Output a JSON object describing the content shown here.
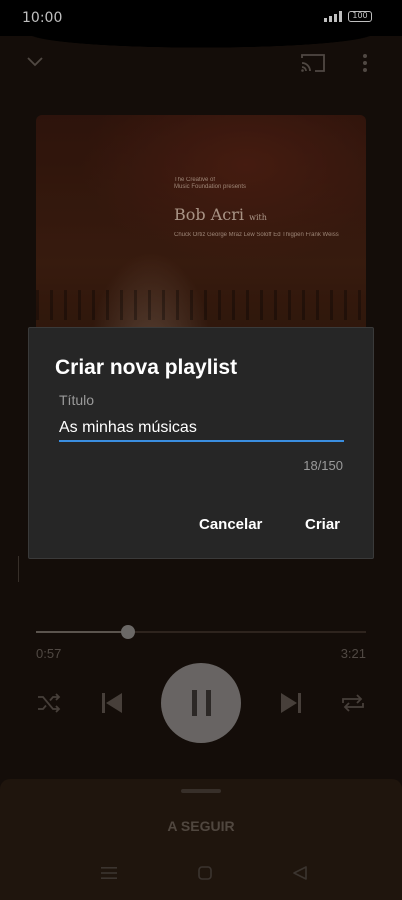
{
  "status": {
    "time": "10:00",
    "battery": "100"
  },
  "album": {
    "credit_line1": "The Creative of",
    "credit_line2": "Music Foundation presents",
    "artist": "Bob Acri",
    "artist_suffix": "with",
    "musicians": "Chuck Ortiz George Mraz Lew Soloff Ed Thigpen Frank Weiss"
  },
  "dialog": {
    "title": "Criar nova playlist",
    "field_label": "Título",
    "field_value": "As minhas músicas",
    "char_count": "18/150",
    "cancel_label": "Cancelar",
    "create_label": "Criar"
  },
  "player": {
    "elapsed": "0:57",
    "duration": "3:21",
    "progress": 0.28
  },
  "up_next": {
    "label": "A SEGUIR"
  },
  "icons": {
    "collapse": "chevron-down-icon",
    "cast": "cast-icon",
    "more": "more-vert-icon",
    "shuffle": "shuffle-icon",
    "previous": "skip-previous-icon",
    "pause": "pause-icon",
    "next": "skip-next-icon",
    "repeat": "repeat-icon",
    "nav_menu": "menu-icon",
    "nav_home": "home-icon",
    "nav_back": "back-icon"
  }
}
